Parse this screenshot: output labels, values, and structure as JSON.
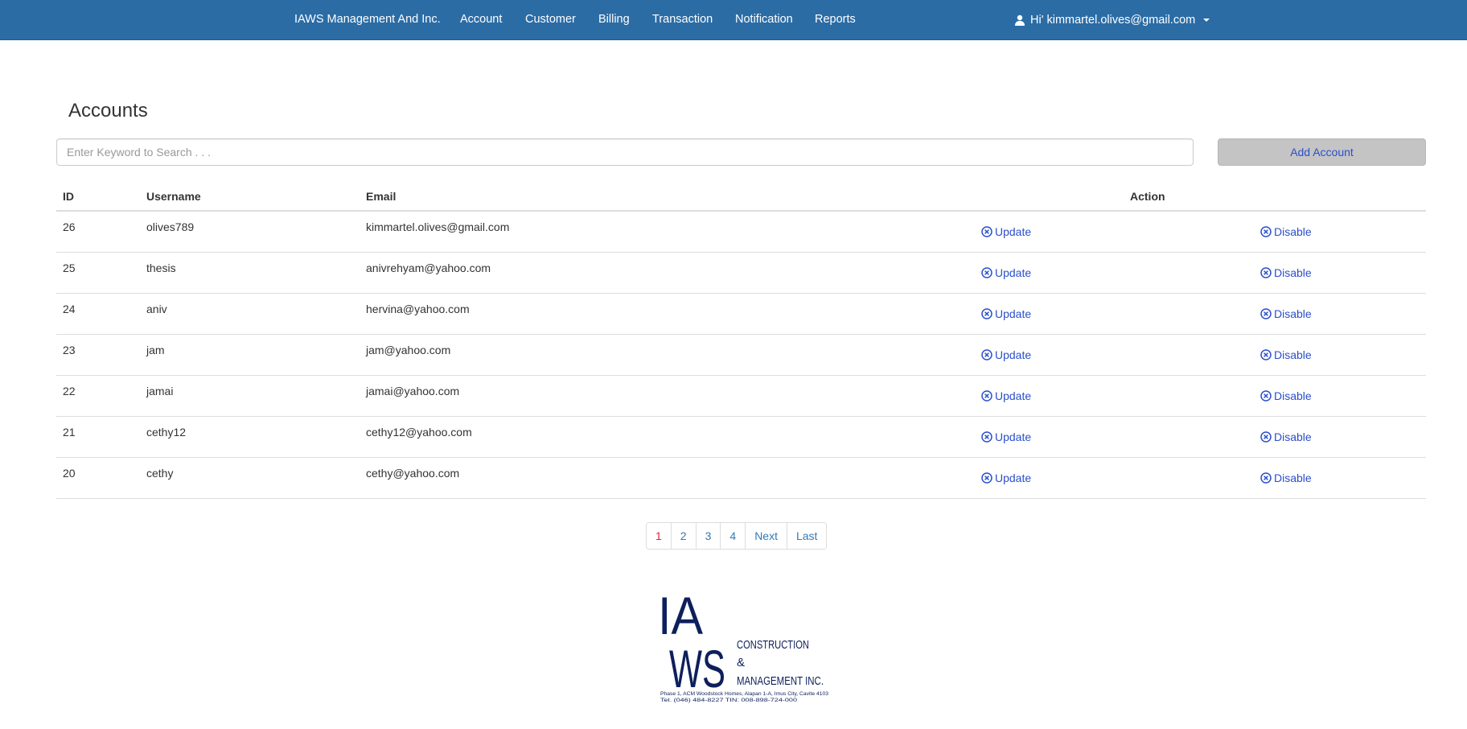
{
  "nav": {
    "brand": "IAWS Management And Inc.",
    "items": [
      "Account",
      "Customer",
      "Billing",
      "Transaction",
      "Notification",
      "Reports"
    ],
    "user_label": "Hi' kimmartel.olives@gmail.com"
  },
  "page": {
    "title": "Accounts"
  },
  "search": {
    "placeholder": "Enter Keyword to Search . . ."
  },
  "add_button": {
    "label": "Add Account"
  },
  "table": {
    "headers": {
      "id": "ID",
      "username": "Username",
      "email": "Email",
      "action": "Action"
    },
    "rows": [
      {
        "id": "26",
        "username": "olives789",
        "email": "kimmartel.olives@gmail.com",
        "update": "Update",
        "disable": "Disable"
      },
      {
        "id": "25",
        "username": "thesis",
        "email": "anivrehyam@yahoo.com",
        "update": "Update",
        "disable": "Disable"
      },
      {
        "id": "24",
        "username": "aniv",
        "email": "hervina@yahoo.com",
        "update": "Update",
        "disable": "Disable"
      },
      {
        "id": "23",
        "username": "jam",
        "email": "jam@yahoo.com",
        "update": "Update",
        "disable": "Disable"
      },
      {
        "id": "22",
        "username": "jamai",
        "email": "jamai@yahoo.com",
        "update": "Update",
        "disable": "Disable"
      },
      {
        "id": "21",
        "username": "cethy12",
        "email": "cethy12@yahoo.com",
        "update": "Update",
        "disable": "Disable"
      },
      {
        "id": "20",
        "username": "cethy",
        "email": "cethy@yahoo.com",
        "update": "Update",
        "disable": "Disable"
      }
    ]
  },
  "pagination": {
    "pages": [
      "1",
      "2",
      "3",
      "4"
    ],
    "next": "Next",
    "last": "Last",
    "current": "1"
  },
  "logo": {
    "line1": "CONSTRUCTION",
    "line2": "&",
    "line3": "MANAGEMENT INC.",
    "address": "Phase 1, ACM Woodstock Homes, Alapan 1-A, Imus City, Cavite 4103",
    "contact": "Tel. (046) 484-8227          TIN: 008-898-724-000"
  },
  "colors": {
    "navbar": "#2b6ca5",
    "link": "#2a4fcc",
    "active_page": "#e0243c",
    "add_button_bg": "#c4c4c4",
    "logo": "#0d1f5c"
  }
}
